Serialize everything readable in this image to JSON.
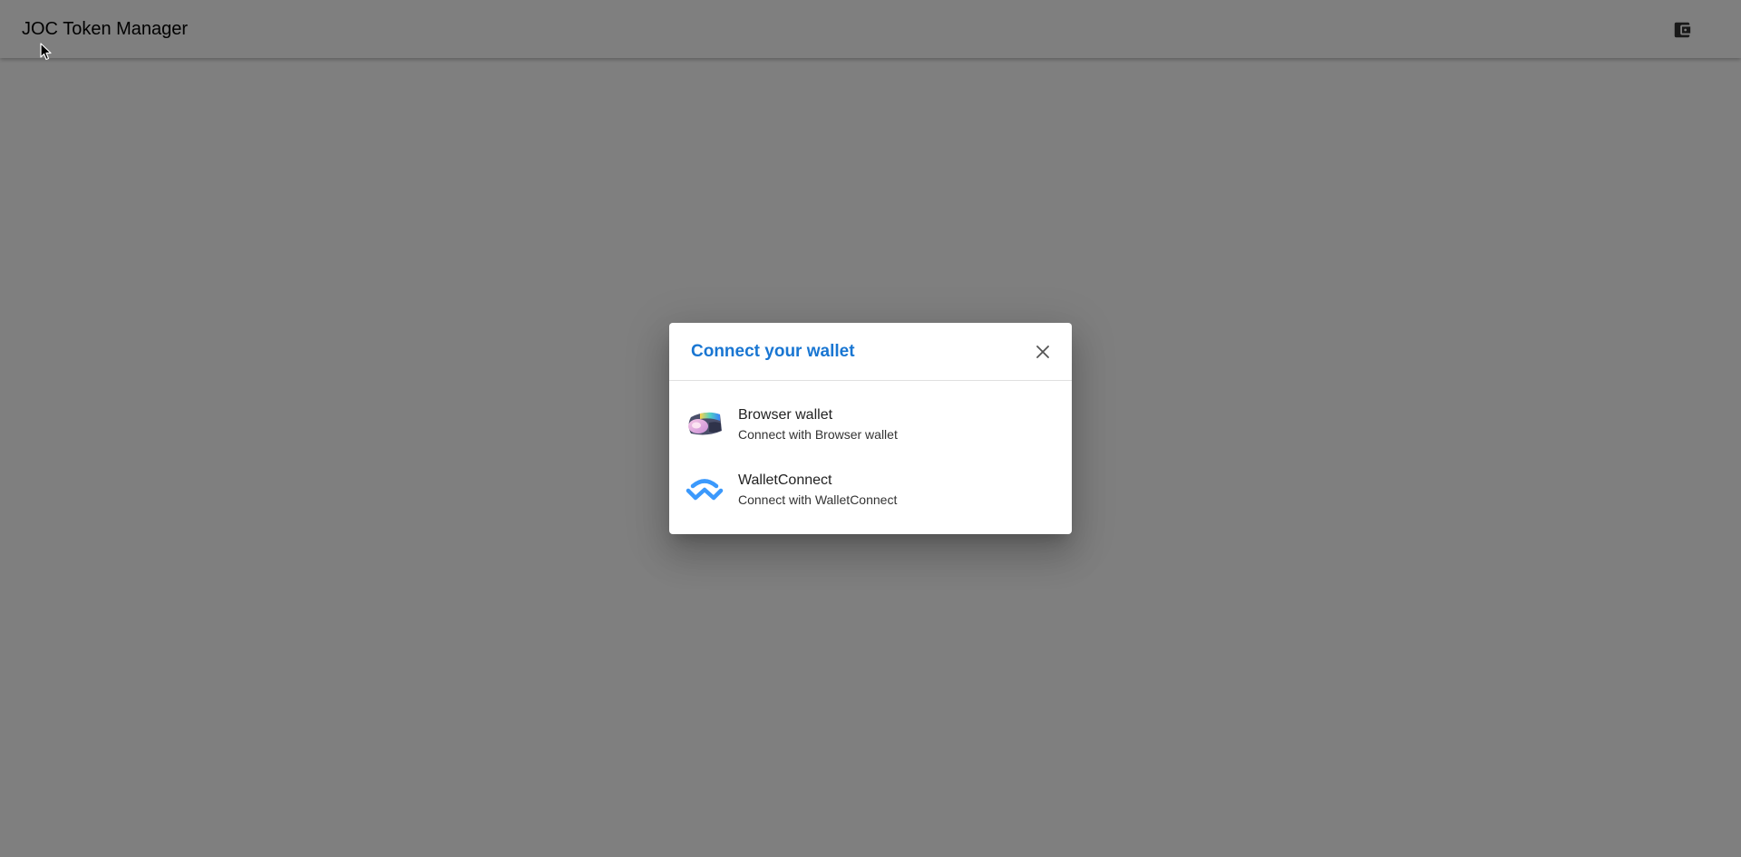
{
  "app": {
    "title": "JOC Token Manager",
    "wallet_icon": "wallet-icon"
  },
  "dialog": {
    "title": "Connect your wallet",
    "close_icon": "close-icon",
    "options": [
      {
        "title": "Browser wallet",
        "subtitle": "Connect with Browser wallet",
        "icon": "browser-wallet-icon"
      },
      {
        "title": "WalletConnect",
        "subtitle": "Connect with WalletConnect",
        "icon": "walletconnect-icon"
      }
    ]
  },
  "colors": {
    "accent": "#1976d2",
    "backdrop": "rgba(0,0,0,0.5)",
    "walletconnect_blue": "#3b99fc"
  }
}
